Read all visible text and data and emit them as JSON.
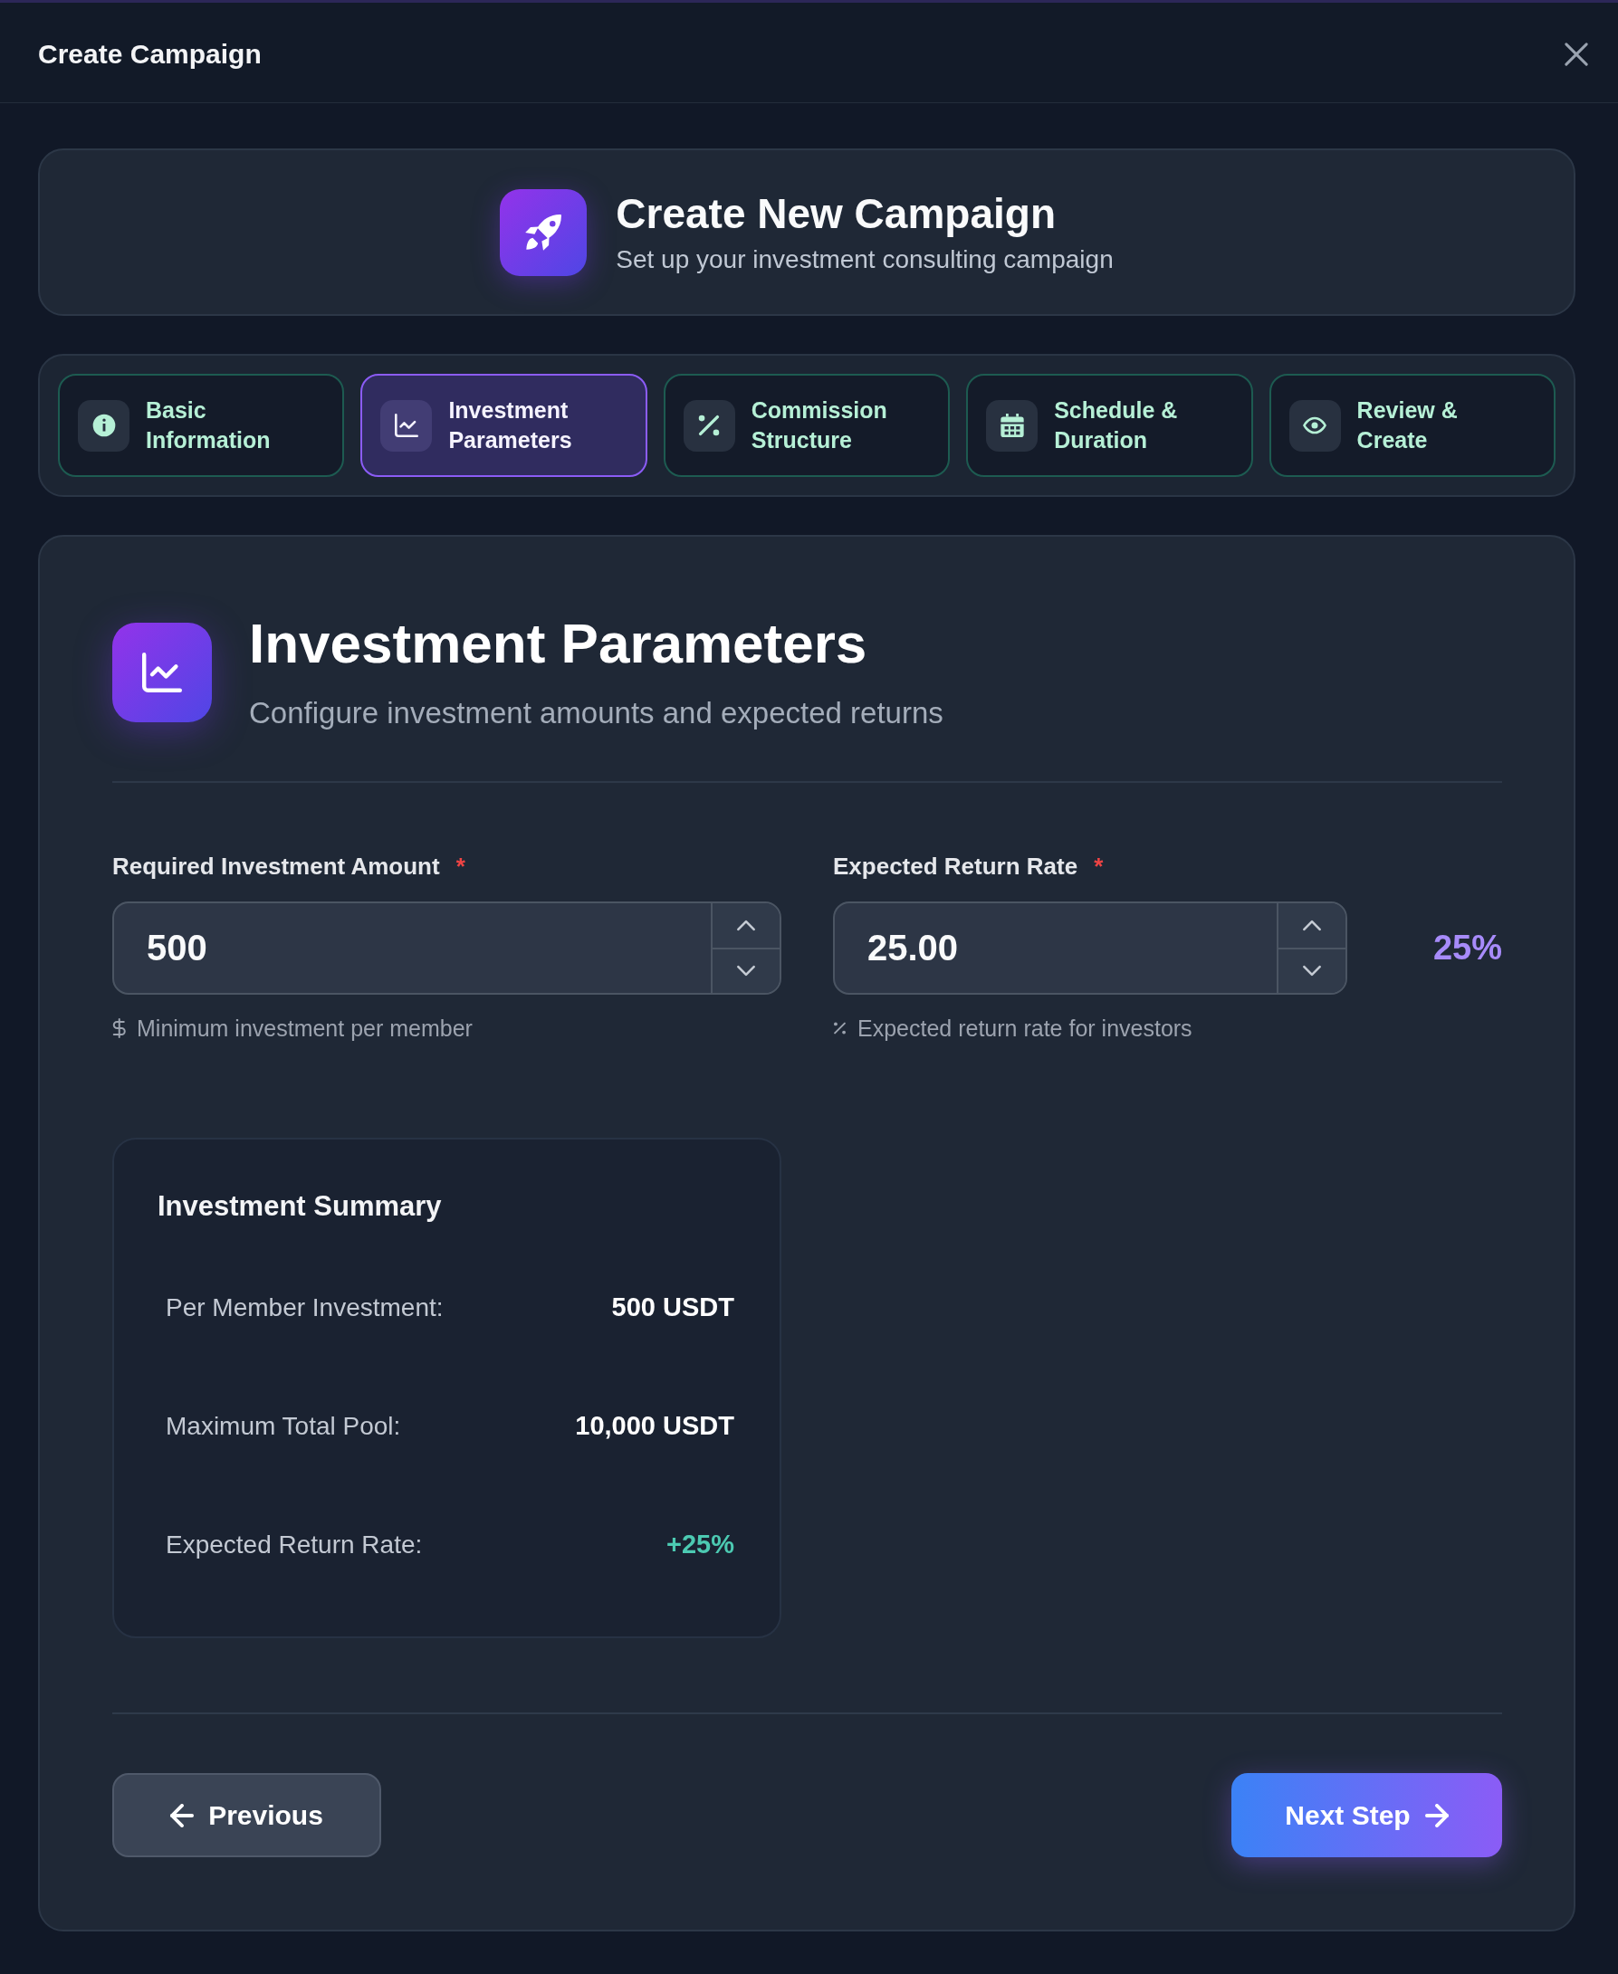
{
  "dialog": {
    "title": "Create Campaign"
  },
  "hero": {
    "title": "Create New Campaign",
    "subtitle": "Set up your investment consulting campaign"
  },
  "steps": [
    {
      "label": "Basic Information",
      "selected": false
    },
    {
      "label": "Investment Parameters",
      "selected": true
    },
    {
      "label": "Commission Structure",
      "selected": false
    },
    {
      "label": "Schedule & Duration",
      "selected": false
    },
    {
      "label": "Review & Create",
      "selected": false
    }
  ],
  "section": {
    "title": "Investment Parameters",
    "subtitle": "Configure investment amounts and expected returns"
  },
  "fields": [
    {
      "label": "Required Investment Amount",
      "required_mark": "*",
      "value": "500",
      "hint": "Minimum investment per member"
    },
    {
      "label": "Expected Return Rate",
      "required_mark": "*",
      "value": "25.00",
      "hint": "Expected return rate for investors",
      "readout": "25%"
    }
  ],
  "summary": {
    "title": "Investment Summary",
    "rows": [
      {
        "label": "Per Member Investment:",
        "value": "500 USDT",
        "kind": "plain"
      },
      {
        "label": "Maximum Total Pool:",
        "value": "10,000 USDT",
        "kind": "plain"
      },
      {
        "label": "Expected Return Rate:",
        "value": "+25%",
        "kind": "positive"
      }
    ]
  },
  "actions": [
    {
      "label": "Previous",
      "kind": "back"
    },
    {
      "label": "Next Step",
      "kind": "forward"
    }
  ]
}
